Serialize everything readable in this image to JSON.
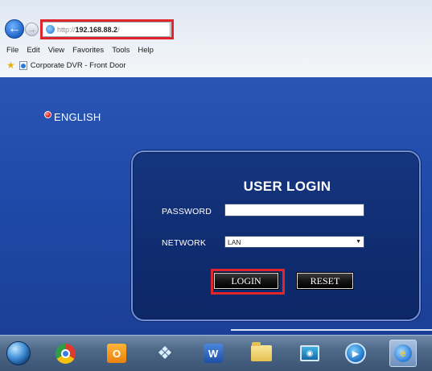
{
  "browser": {
    "back_icon": "back-arrow-icon",
    "forward_icon": "forward-arrow-icon",
    "url_prefix": "http://",
    "url_host": "192.168.88.2",
    "url_suffix": "/",
    "menu": [
      "File",
      "Edit",
      "View",
      "Favorites",
      "Tools",
      "Help"
    ],
    "favorite_label": "Corporate DVR - Front Door",
    "highlight_color": "#e0262b"
  },
  "dvr": {
    "language_label": "ENGLISH",
    "login_title": "USER LOGIN",
    "password_label": "PASSWORD",
    "password_value": "",
    "network_label": "NETWORK",
    "network_value": "LAN",
    "login_button": "LOGIN",
    "reset_button": "RESET",
    "colors": {
      "page_background": "#1f4aa9",
      "panel_background": "#0f2c70",
      "panel_border": "#6f8fd8"
    }
  },
  "taskbar": {
    "icons": [
      "windows-start-icon",
      "chrome-icon",
      "outlook-icon",
      "dropbox-icon",
      "word-icon",
      "file-explorer-icon",
      "remote-viewer-icon",
      "media-player-icon",
      "internet-explorer-icon"
    ]
  }
}
